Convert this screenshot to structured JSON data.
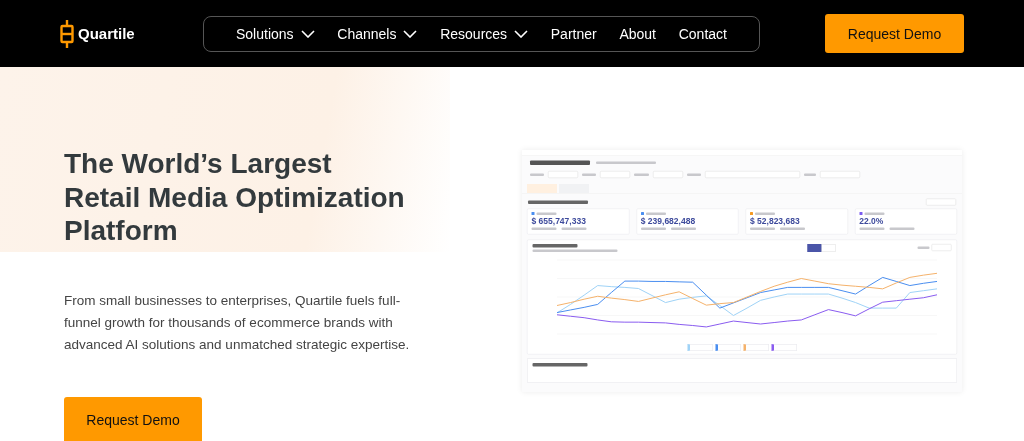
{
  "header": {
    "logo": "Quartile",
    "nav": [
      {
        "label": "Solutions",
        "dropdown": true
      },
      {
        "label": "Channels",
        "dropdown": true
      },
      {
        "label": "Resources",
        "dropdown": true
      },
      {
        "label": "Partner",
        "dropdown": false
      },
      {
        "label": "About",
        "dropdown": false
      },
      {
        "label": "Contact",
        "dropdown": false
      }
    ],
    "cta": "Request Demo"
  },
  "hero": {
    "headline": "The World’s Largest Retail Media Optimization Platform",
    "text": "From small businesses to enterprises, Quartile fuels full-funnel growth for thousands of ecommerce brands with advanced AI solutions and unmatched strategic expertise.",
    "cta": "Request Demo"
  },
  "dashboard": {
    "cards": [
      {
        "color": "#4a8ef0",
        "value": "$ 655,747,333"
      },
      {
        "color": "#4a8ef0",
        "value": "$ 239,682,488"
      },
      {
        "color": "#f59a23",
        "value": "$ 52,823,683"
      },
      {
        "color": "#7b5cf0",
        "value": "22.0%"
      }
    ]
  }
}
